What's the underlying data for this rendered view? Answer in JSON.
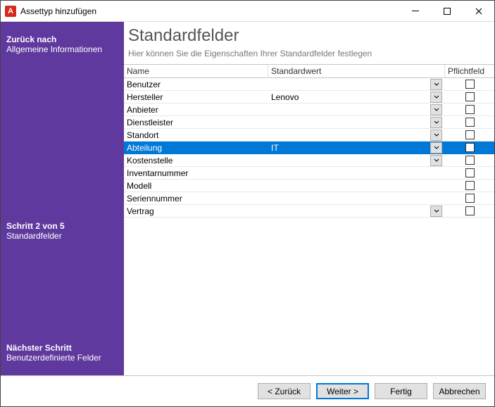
{
  "window": {
    "title": "Assettyp hinzufügen"
  },
  "sidebar": {
    "back_line1": "Zurück nach",
    "back_line2": "Allgemeine Informationen",
    "current_line1": "Schritt 2 von 5",
    "current_line2": "Standardfelder",
    "next_line1": "Nächster Schritt",
    "next_line2": "Benutzerdefinierte Felder"
  },
  "main": {
    "heading": "Standardfelder",
    "subtitle": "Hier können Sie die Eigenschaften Ihrer Standardfelder festlegen"
  },
  "columns": {
    "name": "Name",
    "default": "Standardwert",
    "required": "Pflichtfeld"
  },
  "rows": [
    {
      "name": "Benutzer",
      "value": "",
      "dropdown": true,
      "required": false,
      "selected": false
    },
    {
      "name": "Hersteller",
      "value": "Lenovo",
      "dropdown": true,
      "required": false,
      "selected": false
    },
    {
      "name": "Anbieter",
      "value": "",
      "dropdown": true,
      "required": false,
      "selected": false
    },
    {
      "name": "Dienstleister",
      "value": "",
      "dropdown": true,
      "required": false,
      "selected": false
    },
    {
      "name": "Standort",
      "value": "",
      "dropdown": true,
      "required": false,
      "selected": false
    },
    {
      "name": "Abteilung",
      "value": "IT",
      "dropdown": true,
      "required": false,
      "selected": true
    },
    {
      "name": "Kostenstelle",
      "value": "",
      "dropdown": true,
      "required": false,
      "selected": false
    },
    {
      "name": "Inventarnummer",
      "value": "",
      "dropdown": false,
      "required": false,
      "selected": false
    },
    {
      "name": "Modell",
      "value": "",
      "dropdown": false,
      "required": false,
      "selected": false
    },
    {
      "name": "Seriennummer",
      "value": "",
      "dropdown": false,
      "required": false,
      "selected": false
    },
    {
      "name": "Vertrag",
      "value": "",
      "dropdown": true,
      "required": false,
      "selected": false
    }
  ],
  "footer": {
    "back": "< Zurück",
    "next": "Weiter >",
    "finish": "Fertig",
    "cancel": "Abbrechen"
  }
}
